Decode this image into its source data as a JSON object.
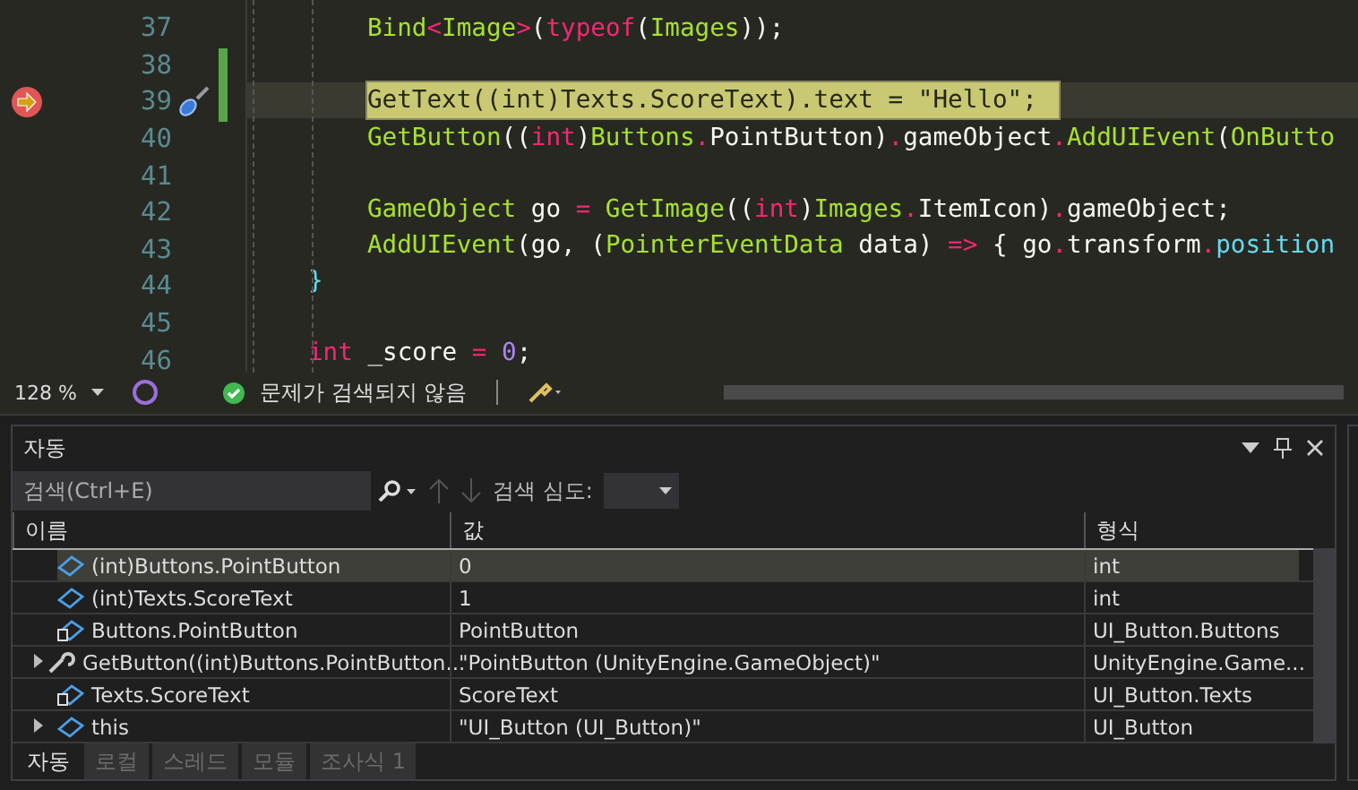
{
  "editor": {
    "lines": [
      {
        "number": "37",
        "current": false,
        "changed": false,
        "kind": "statement",
        "tokens": [
          {
            "kind": "fn",
            "text": "Bind"
          },
          {
            "kind": "kw",
            "text": "<"
          },
          {
            "kind": "type",
            "text": "Image"
          },
          {
            "kind": "kw",
            "text": ">"
          },
          {
            "kind": "punct",
            "text": "("
          },
          {
            "kind": "kw",
            "text": "typeof"
          },
          {
            "kind": "punct",
            "text": "("
          },
          {
            "kind": "type",
            "text": "Images"
          },
          {
            "kind": "punct",
            "text": "));"
          }
        ]
      },
      {
        "number": "38",
        "current": false,
        "changed": true,
        "kind": "blank"
      },
      {
        "number": "39",
        "current": true,
        "changed": true,
        "kind": "statement",
        "tokens": [
          {
            "kind": "fn",
            "text": "GetText"
          },
          {
            "kind": "punct",
            "text": "(("
          },
          {
            "kind": "kw",
            "text": "int"
          },
          {
            "kind": "punct",
            "text": ")"
          },
          {
            "kind": "type",
            "text": "Texts"
          },
          {
            "kind": "punct",
            "text": "."
          },
          {
            "kind": "plain",
            "text": "ScoreText"
          },
          {
            "kind": "punct",
            "text": ")."
          },
          {
            "kind": "plain",
            "text": "text"
          },
          {
            "kind": "punct",
            "text": " = "
          },
          {
            "kind": "str",
            "text": "\"Hello\""
          },
          {
            "kind": "punct",
            "text": ";"
          }
        ]
      },
      {
        "number": "40",
        "current": false,
        "changed": false,
        "kind": "statement",
        "tokens": [
          {
            "kind": "fn",
            "text": "GetButton"
          },
          {
            "kind": "punct",
            "text": "(("
          },
          {
            "kind": "kw",
            "text": "int"
          },
          {
            "kind": "punct",
            "text": ")"
          },
          {
            "kind": "type",
            "text": "Buttons"
          },
          {
            "kind": "kw",
            "text": "."
          },
          {
            "kind": "plain",
            "text": "PointButton"
          },
          {
            "kind": "punct",
            "text": ")"
          },
          {
            "kind": "kw",
            "text": "."
          },
          {
            "kind": "plain",
            "text": "gameObject"
          },
          {
            "kind": "kw",
            "text": "."
          },
          {
            "kind": "fn",
            "text": "AddUIEvent"
          },
          {
            "kind": "punct",
            "text": "("
          },
          {
            "kind": "fn",
            "text": "OnButto"
          }
        ]
      },
      {
        "number": "41",
        "current": false,
        "changed": false,
        "kind": "blank"
      },
      {
        "number": "42",
        "current": false,
        "changed": false,
        "kind": "statement",
        "tokens": [
          {
            "kind": "type",
            "text": "GameObject"
          },
          {
            "kind": "plain",
            "text": " go "
          },
          {
            "kind": "kw",
            "text": "="
          },
          {
            "kind": "fn",
            "text": " GetImage"
          },
          {
            "kind": "punct",
            "text": "(("
          },
          {
            "kind": "kw",
            "text": "int"
          },
          {
            "kind": "punct",
            "text": ")"
          },
          {
            "kind": "type",
            "text": "Images"
          },
          {
            "kind": "kw",
            "text": "."
          },
          {
            "kind": "plain",
            "text": "ItemIcon"
          },
          {
            "kind": "punct",
            "text": ")"
          },
          {
            "kind": "kw",
            "text": "."
          },
          {
            "kind": "plain",
            "text": "gameObject"
          },
          {
            "kind": "punct",
            "text": ";"
          }
        ]
      },
      {
        "number": "43",
        "current": false,
        "changed": false,
        "kind": "statement",
        "tokens": [
          {
            "kind": "fn",
            "text": "AddUIEvent"
          },
          {
            "kind": "punct",
            "text": "("
          },
          {
            "kind": "plain",
            "text": "go"
          },
          {
            "kind": "punct",
            "text": ", ("
          },
          {
            "kind": "type",
            "text": "PointerEventData"
          },
          {
            "kind": "plain",
            "text": " data"
          },
          {
            "kind": "punct",
            "text": ") "
          },
          {
            "kind": "kw",
            "text": "=>"
          },
          {
            "kind": "punct",
            "text": " { "
          },
          {
            "kind": "plain",
            "text": "go"
          },
          {
            "kind": "kw",
            "text": "."
          },
          {
            "kind": "plain",
            "text": "transform"
          },
          {
            "kind": "kw",
            "text": "."
          },
          {
            "kind": "member",
            "text": "position"
          }
        ]
      },
      {
        "number": "44",
        "current": false,
        "changed": false,
        "kind": "member",
        "tokens": [
          {
            "kind": "member",
            "text": "}"
          }
        ]
      },
      {
        "number": "45",
        "current": false,
        "changed": false,
        "kind": "blank"
      },
      {
        "number": "46",
        "current": false,
        "changed": false,
        "kind": "member",
        "tokens": [
          {
            "kind": "kw",
            "text": "int"
          },
          {
            "kind": "plain",
            "text": " _score "
          },
          {
            "kind": "kw",
            "text": "="
          },
          {
            "kind": "num",
            "text": " 0"
          },
          {
            "kind": "punct",
            "text": ";"
          }
        ]
      }
    ]
  },
  "status_bar": {
    "zoom": "128 %",
    "issues": "문제가 검색되지 않음"
  },
  "autos_panel": {
    "title": "자동",
    "search": {
      "placeholder": "검색(Ctrl+E)"
    },
    "search_depth_label": "검색 심도:",
    "columns": [
      "이름",
      "값",
      "형식"
    ],
    "rows": [
      {
        "kind": "field",
        "expandable": false,
        "selected": true,
        "name": "(int)Buttons.PointButton",
        "value": "0",
        "type": "int"
      },
      {
        "kind": "field",
        "expandable": false,
        "selected": false,
        "name": "(int)Texts.ScoreText",
        "value": "1",
        "type": "int"
      },
      {
        "kind": "enum",
        "expandable": false,
        "selected": false,
        "name": "Buttons.PointButton",
        "value": "PointButton",
        "type": "UI_Button.Buttons"
      },
      {
        "kind": "method",
        "expandable": true,
        "selected": false,
        "name": "GetButton((int)Buttons.PointButton...",
        "value": "\"PointButton (UnityEngine.GameObject)\"",
        "type": "UnityEngine.Game..."
      },
      {
        "kind": "enum",
        "expandable": false,
        "selected": false,
        "name": "Texts.ScoreText",
        "value": "ScoreText",
        "type": "UI_Button.Texts"
      },
      {
        "kind": "field",
        "expandable": true,
        "selected": false,
        "name": "this",
        "value": "\"UI_Button (UI_Button)\"",
        "type": "UI_Button"
      }
    ],
    "tabs": [
      {
        "label": "자동",
        "selected": true
      },
      {
        "label": "로컬",
        "selected": false
      },
      {
        "label": "스레드",
        "selected": false
      },
      {
        "label": "모듈",
        "selected": false
      },
      {
        "label": "조사식 1",
        "selected": false
      }
    ]
  }
}
